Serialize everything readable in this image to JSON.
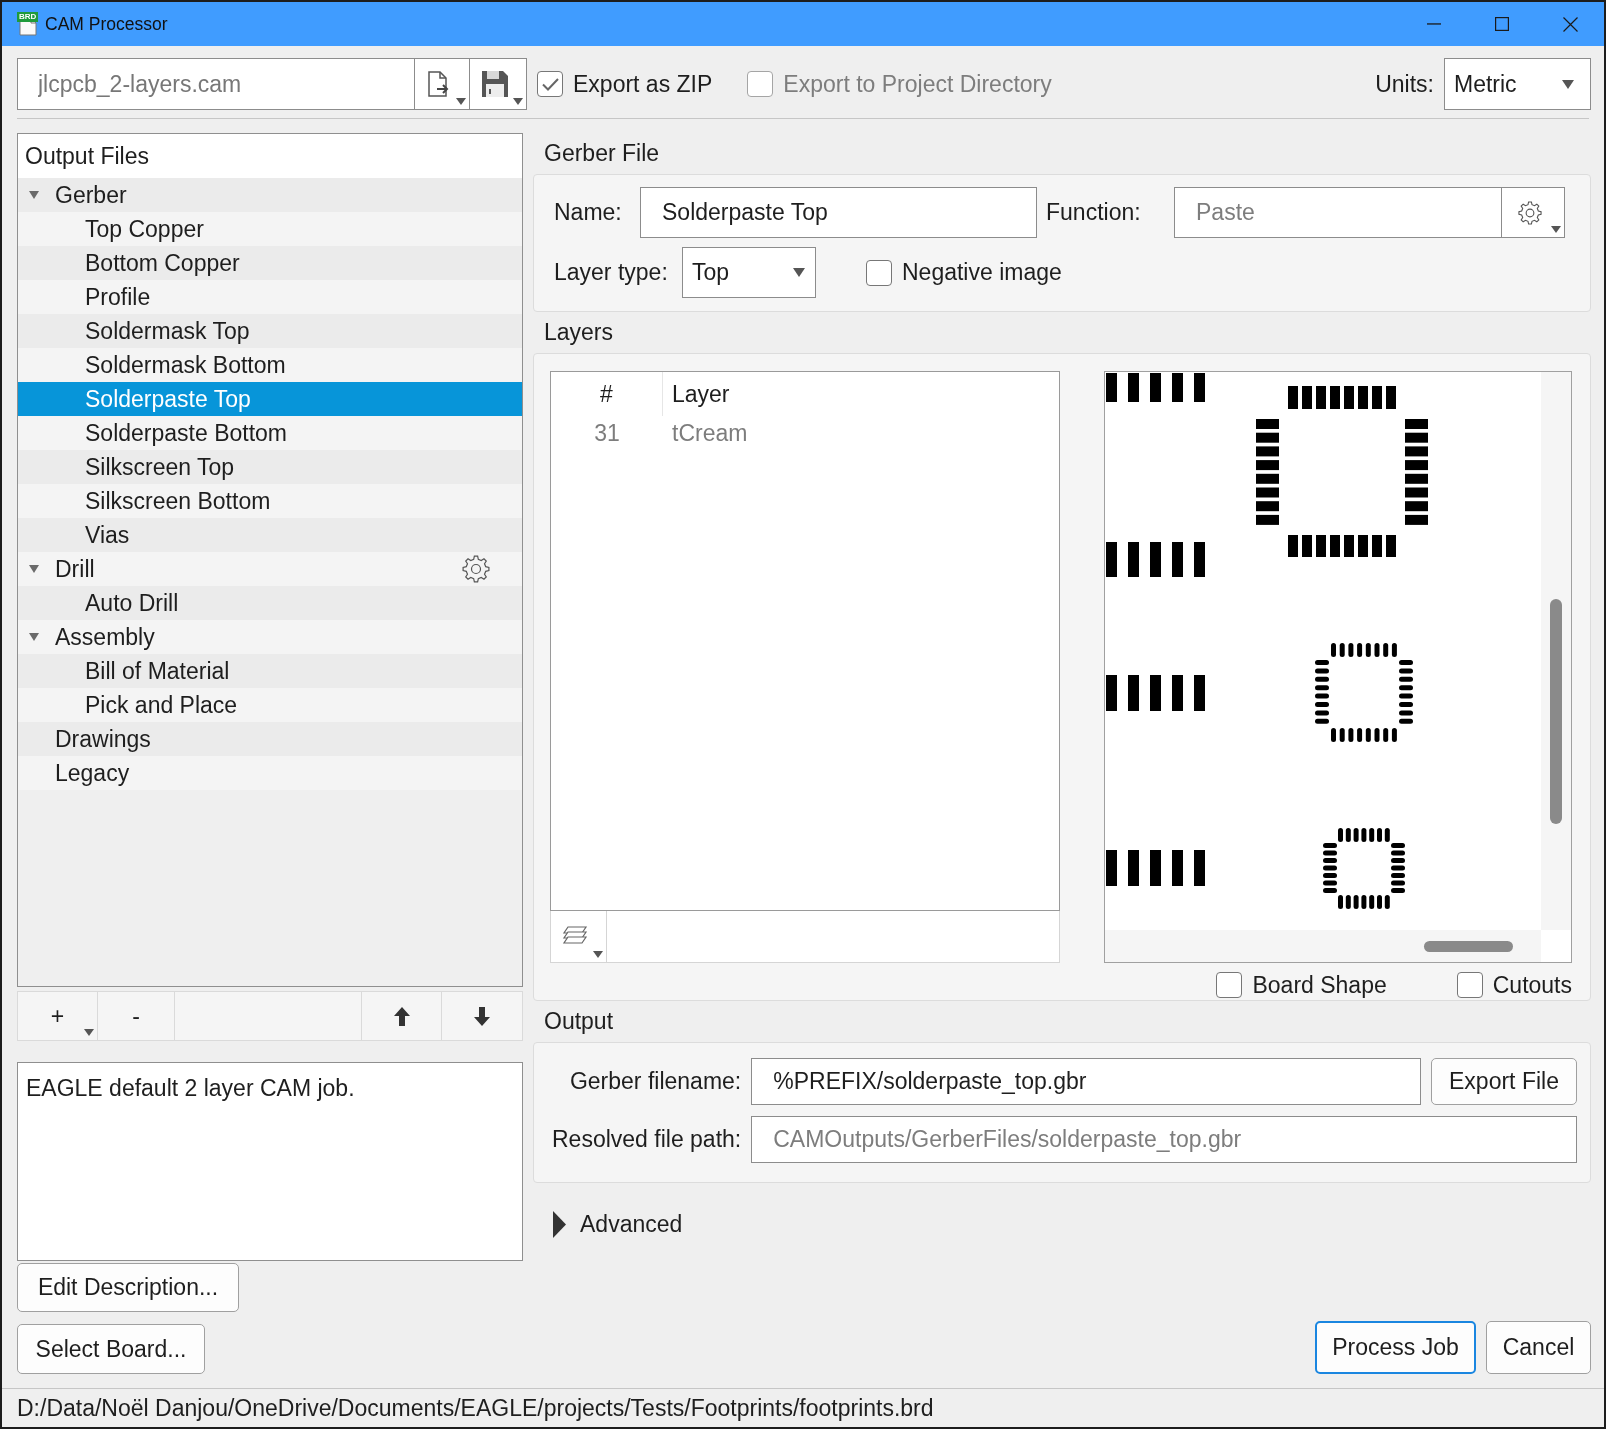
{
  "window": {
    "title": "CAM Processor",
    "icon_badge": "BRD"
  },
  "toolbar": {
    "job_file": "jlcpcb_2-layers.cam",
    "export_zip": {
      "label": "Export as ZIP",
      "checked": true,
      "disabled": false
    },
    "export_to_project": {
      "label": "Export to Project Directory",
      "checked": false,
      "disabled": true
    },
    "units": {
      "label": "Units:",
      "value": "Metric"
    }
  },
  "output_files": {
    "title": "Output Files",
    "items": [
      {
        "label": "Gerber",
        "selected": false,
        "expanded": true,
        "settings_icon": false,
        "children": [
          {
            "label": "Top Copper",
            "selected": false,
            "settings_icon": false
          },
          {
            "label": "Bottom Copper",
            "selected": false,
            "settings_icon": false
          },
          {
            "label": "Profile",
            "selected": false,
            "settings_icon": false
          },
          {
            "label": "Soldermask Top",
            "selected": false,
            "settings_icon": false
          },
          {
            "label": "Soldermask Bottom",
            "selected": false,
            "settings_icon": false
          },
          {
            "label": "Solderpaste Top",
            "selected": true,
            "settings_icon": false
          },
          {
            "label": "Solderpaste Bottom",
            "selected": false,
            "settings_icon": false
          },
          {
            "label": "Silkscreen Top",
            "selected": false,
            "settings_icon": false
          },
          {
            "label": "Silkscreen Bottom",
            "selected": false,
            "settings_icon": false
          },
          {
            "label": "Vias",
            "selected": false,
            "settings_icon": false
          }
        ]
      },
      {
        "label": "Drill",
        "selected": false,
        "expanded": true,
        "settings_icon": true,
        "children": [
          {
            "label": "Auto Drill",
            "selected": false,
            "settings_icon": false
          }
        ]
      },
      {
        "label": "Assembly",
        "selected": false,
        "expanded": true,
        "settings_icon": false,
        "children": [
          {
            "label": "Bill of Material",
            "selected": false,
            "settings_icon": false
          },
          {
            "label": "Pick and Place",
            "selected": false,
            "settings_icon": false
          }
        ]
      },
      {
        "label": "Drawings",
        "selected": false,
        "settings_icon": false
      },
      {
        "label": "Legacy",
        "selected": false,
        "settings_icon": false
      }
    ]
  },
  "tree_buttons": {
    "add": "+",
    "remove": "-"
  },
  "description": "EAGLE default 2 layer CAM job.",
  "left_buttons": [
    "Edit Description...",
    "Select Board..."
  ],
  "gerber_file": {
    "title": "Gerber File",
    "name": {
      "label": "Name:",
      "value": "Solderpaste Top"
    },
    "function": {
      "label": "Function:",
      "value": "Paste",
      "disabled": true
    },
    "layer_type": {
      "label": "Layer type:",
      "value": "Top"
    },
    "negative_image": {
      "label": "Negative image",
      "checked": false
    }
  },
  "layers": {
    "title": "Layers",
    "columns": [
      "#",
      "Layer"
    ],
    "rows": [
      {
        "number": "31",
        "name": "tCream",
        "disabled": true
      }
    ],
    "board_shape": {
      "label": "Board Shape",
      "checked": false
    },
    "cutouts": {
      "label": "Cutouts",
      "checked": false
    }
  },
  "output": {
    "title": "Output",
    "gerber_filename": {
      "label": "Gerber filename:",
      "value": "%PREFIX/solderpaste_top.gbr"
    },
    "export_button": "Export File",
    "resolved_path": {
      "label": "Resolved file path:",
      "value": "CAMOutputs/GerberFiles/solderpaste_top.gbr"
    }
  },
  "advanced": {
    "label": "Advanced",
    "expanded": false
  },
  "footer_buttons": [
    {
      "label": "Process Job",
      "default": true
    },
    {
      "label": "Cancel",
      "default": false
    }
  ],
  "status_bar": "D:/Data/Noël Danjou/OneDrive/Documents/EAGLE/projects/Tests/Footprints/footprints.brd"
}
